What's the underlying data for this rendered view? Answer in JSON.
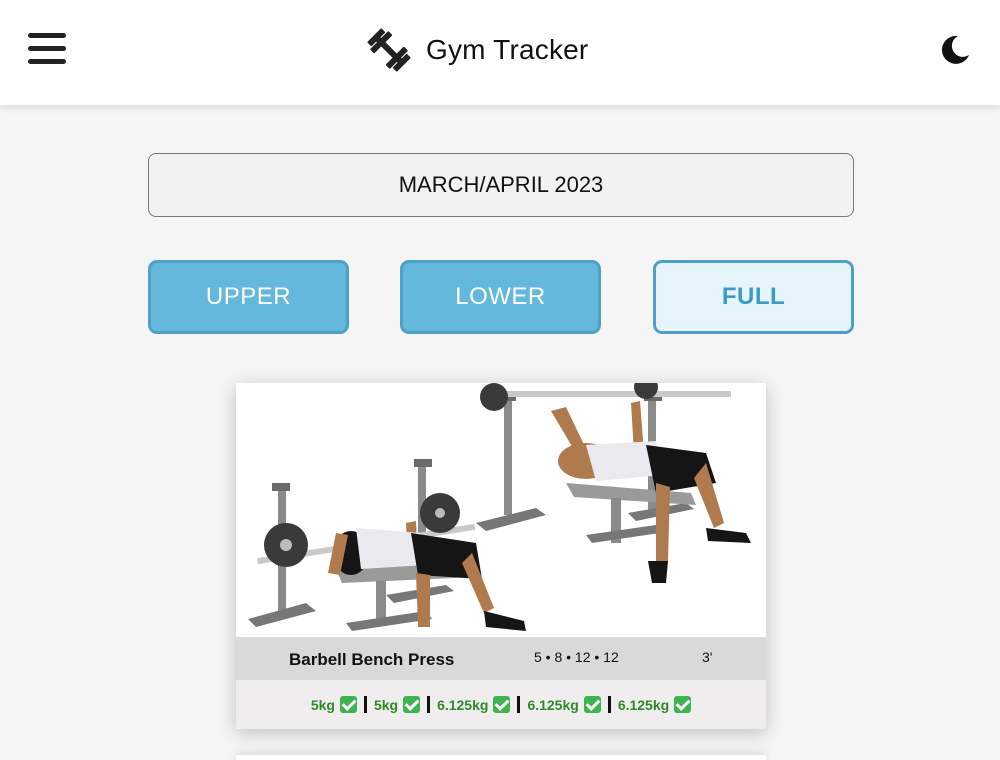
{
  "header": {
    "menu_icon": "hamburger-menu-icon",
    "brand_icon": "dumbbell-icon",
    "title": "Gym Tracker",
    "theme_icon": "moon-icon"
  },
  "period": {
    "label": "MARCH/APRIL 2023"
  },
  "tabs": [
    {
      "label": "UPPER",
      "active": false
    },
    {
      "label": "LOWER",
      "active": false
    },
    {
      "label": "FULL",
      "active": true
    }
  ],
  "exercise": {
    "image": "barbell-bench-press-illustration",
    "name": "Barbell Bench Press",
    "reps": "5 • 8 • 12 • 12",
    "rest": "3'",
    "sets": [
      {
        "weight": "5kg",
        "done": true
      },
      {
        "weight": "5kg",
        "done": true
      },
      {
        "weight": "6.125kg",
        "done": true
      },
      {
        "weight": "6.125kg",
        "done": true
      },
      {
        "weight": "6.125kg",
        "done": true
      }
    ]
  },
  "colors": {
    "tab_inactive": "#63b8dc",
    "tab_active_bg": "#e6f5fc",
    "tab_border": "#4fa0c7",
    "done_green": "#2f8a2a"
  }
}
